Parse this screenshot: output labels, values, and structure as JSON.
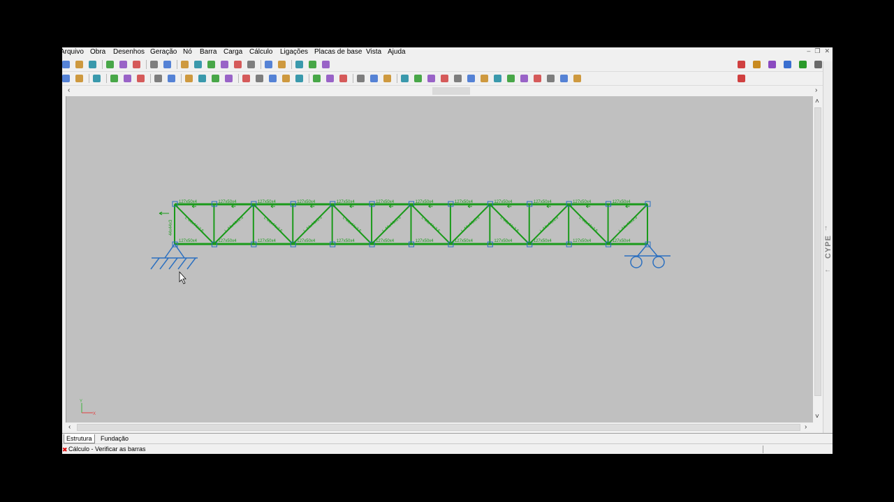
{
  "menu": [
    "Arquivo",
    "Obra",
    "Desenhos",
    "Geração",
    "Nó",
    "Barra",
    "Carga",
    "Cálculo",
    "Ligações",
    "Placas de base",
    "Vista",
    "Ajuda"
  ],
  "canvas": {
    "beam_label": "127x50x4",
    "diag_label": "L 44x44x3.5",
    "vert_label": "44x44x3",
    "axis_y": "Y",
    "axis_x": "X"
  },
  "side_tab": "CYPE",
  "tabs": [
    "Estrutura",
    "Fundação"
  ],
  "status": "Cálculo - Verificar as barras",
  "colors": {
    "truss": "#1a9a1a",
    "support": "#2a6fc0",
    "viewport": "#c0c0c0"
  }
}
